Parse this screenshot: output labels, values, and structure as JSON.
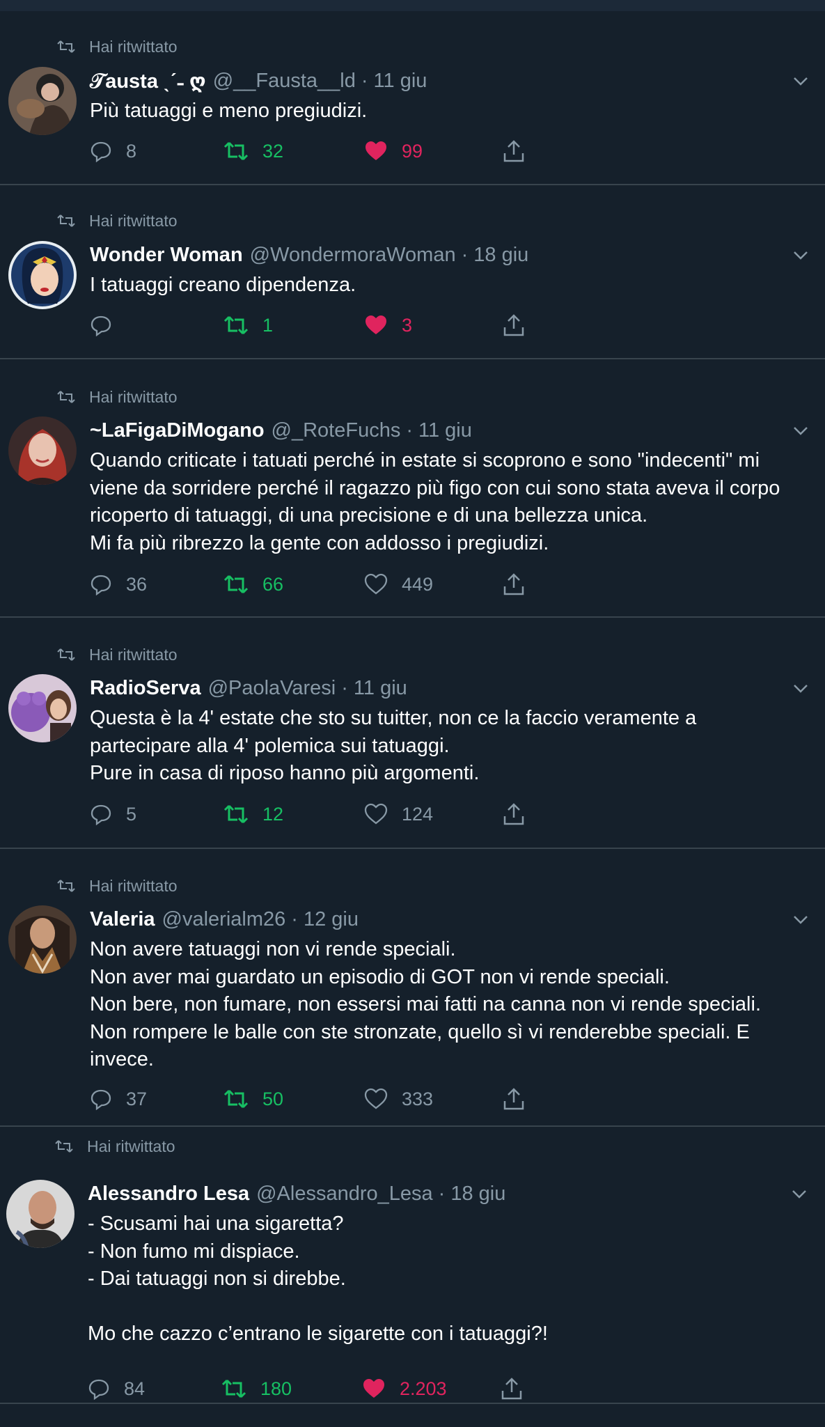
{
  "retweet_label": "Hai ritwittato",
  "tweets": [
    {
      "name": "𝒯austa ˎˊ˗ ღ",
      "handle": "@__Fausta__ld",
      "dot": "·",
      "date": "11 giu",
      "text": "Più tatuaggi e meno pregiudizi.",
      "replies": "8",
      "retweets": "32",
      "likes": "99",
      "liked": true
    },
    {
      "name": "Wonder Woman",
      "handle": "@WondermoraWoman",
      "dot": "·",
      "date": "18 giu",
      "text": "I tatuaggi creano dipendenza.",
      "replies": "",
      "retweets": "1",
      "likes": "3",
      "liked": true
    },
    {
      "name": "~LaFigaDiMogano",
      "handle": "@_RoteFuchs",
      "dot": "·",
      "date": "11 giu",
      "text": "Quando criticate i tatuati perché in estate si scoprono e sono \"indecenti\" mi\nviene da sorridere perché il ragazzo più figo con cui sono stata aveva il corpo\nricoperto di tatuaggi, di una precisione e di una bellezza unica.\nMi fa più ribrezzo la gente con addosso i pregiudizi.",
      "replies": "36",
      "retweets": "66",
      "likes": "449",
      "liked": false
    },
    {
      "name": "RadioServa",
      "handle": "@PaolaVaresi",
      "dot": "·",
      "date": "11 giu",
      "text": "Questa è la 4' estate che sto su tuitter, non ce la faccio veramente a\npartecipare alla 4' polemica sui tatuaggi.\nPure in casa di riposo hanno più argomenti.",
      "replies": "5",
      "retweets": "12",
      "likes": "124",
      "liked": false
    },
    {
      "name": "Valeria",
      "handle": "@valerialm26",
      "dot": "·",
      "date": "12 giu",
      "text": "Non avere tatuaggi non vi rende speciali.\nNon aver mai guardato un episodio di GOT non vi rende speciali.\nNon bere, non fumare, non essersi mai fatti na canna non vi rende speciali.\nNon rompere le balle con ste stronzate, quello sì vi renderebbe speciali. E\ninvece.",
      "replies": "37",
      "retweets": "50",
      "likes": "333",
      "liked": false
    },
    {
      "name": "Alessandro Lesa",
      "handle": "@Alessandro_Lesa",
      "dot": "·",
      "date": "18 giu",
      "text": "- Scusami hai una sigaretta?\n- Non fumo mi dispiace.\n- Dai tatuaggi non si direbbe.\n\nMo che cazzo c’entrano le sigarette con i tatuaggi?!",
      "replies": "84",
      "retweets": "180",
      "likes": "2.203",
      "liked": true
    }
  ],
  "colors": {
    "background": "#15202b",
    "divider": "#38444d",
    "secondary_text": "#8899a6",
    "retweet_green": "#17bf63",
    "like_pink": "#e0245e"
  },
  "icons": {
    "retweet": "retweet-icon",
    "reply": "reply-icon",
    "like": "heart-icon",
    "share": "share-icon",
    "menu": "chevron-down-icon"
  }
}
